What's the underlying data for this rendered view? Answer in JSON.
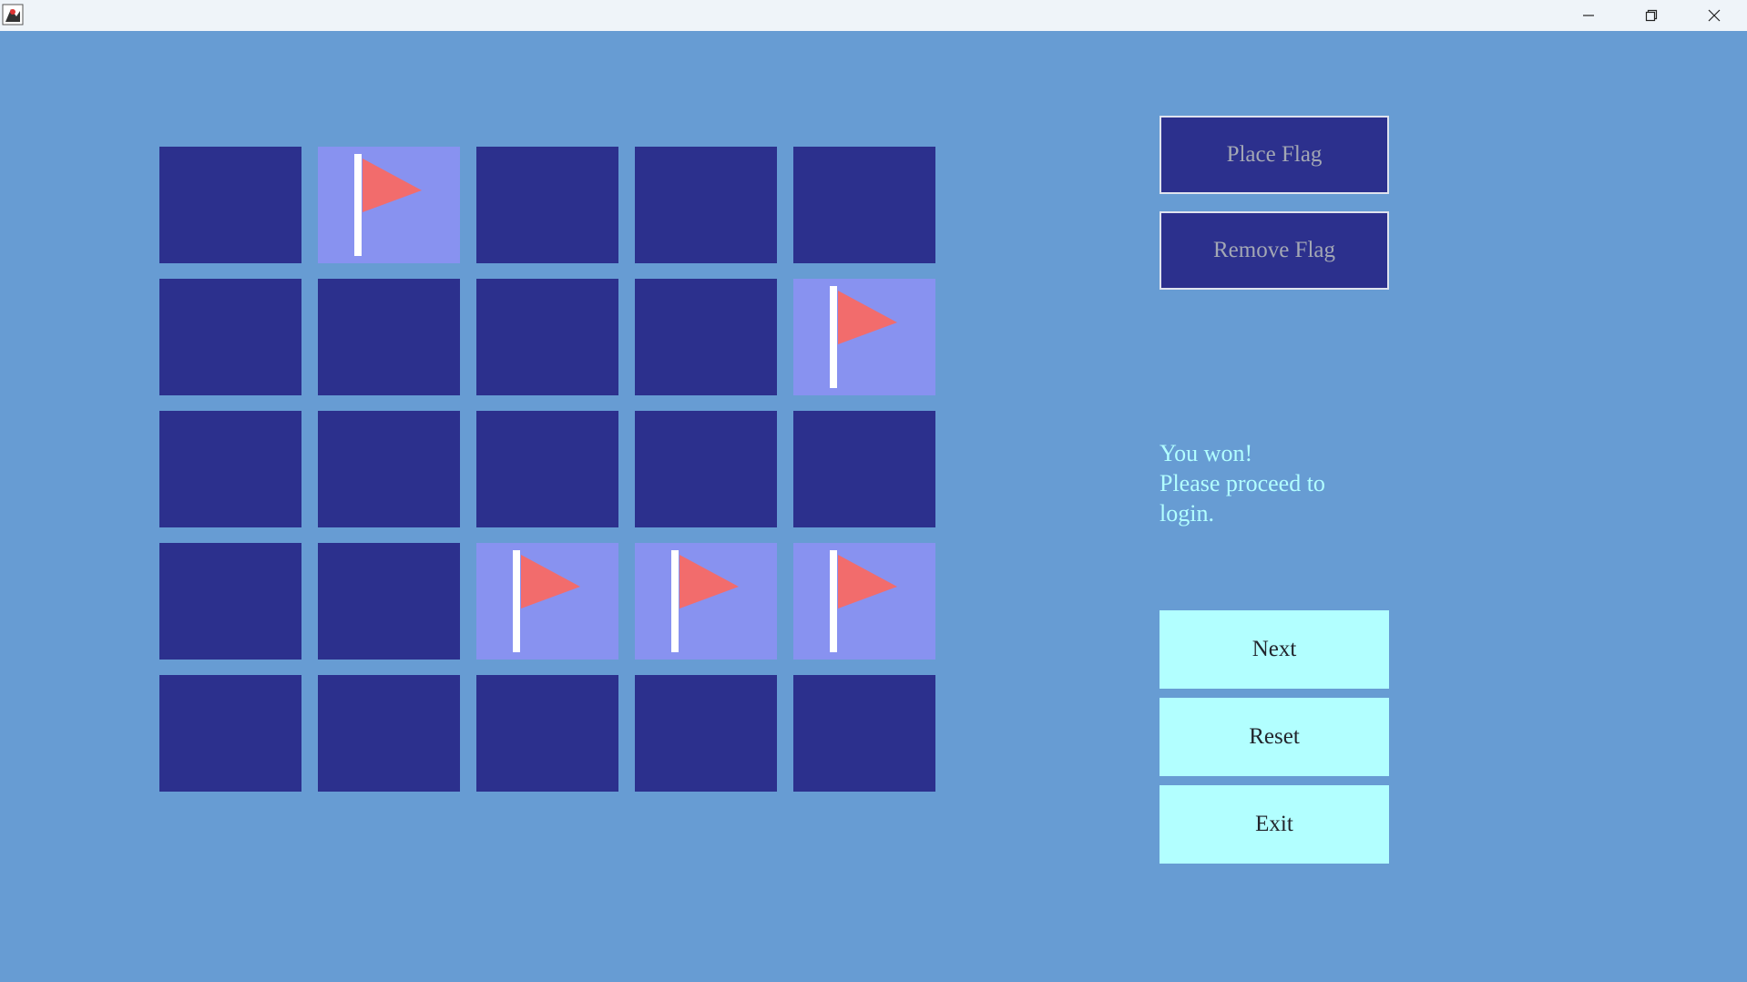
{
  "window": {
    "app_icon": "java-duke-icon",
    "controls": [
      "minimize-icon",
      "restore-icon",
      "close-icon"
    ]
  },
  "board": {
    "rows": 5,
    "cols": 5,
    "cells": [
      [
        false,
        true,
        false,
        false,
        false
      ],
      [
        false,
        false,
        false,
        false,
        true
      ],
      [
        false,
        false,
        false,
        false,
        false
      ],
      [
        false,
        false,
        true,
        true,
        true
      ],
      [
        false,
        false,
        false,
        false,
        false
      ]
    ],
    "colors": {
      "covered": "#2c308d",
      "flagged": "#8892f0",
      "flag": "#f26c6c",
      "pole": "#ffffff"
    }
  },
  "controls": {
    "place_flag": "Place Flag",
    "remove_flag": "Remove Flag",
    "next": "Next",
    "reset": "Reset",
    "exit": "Exit"
  },
  "status": {
    "line1": "You won!",
    "line2": "Please proceed to",
    "line3": "login."
  }
}
